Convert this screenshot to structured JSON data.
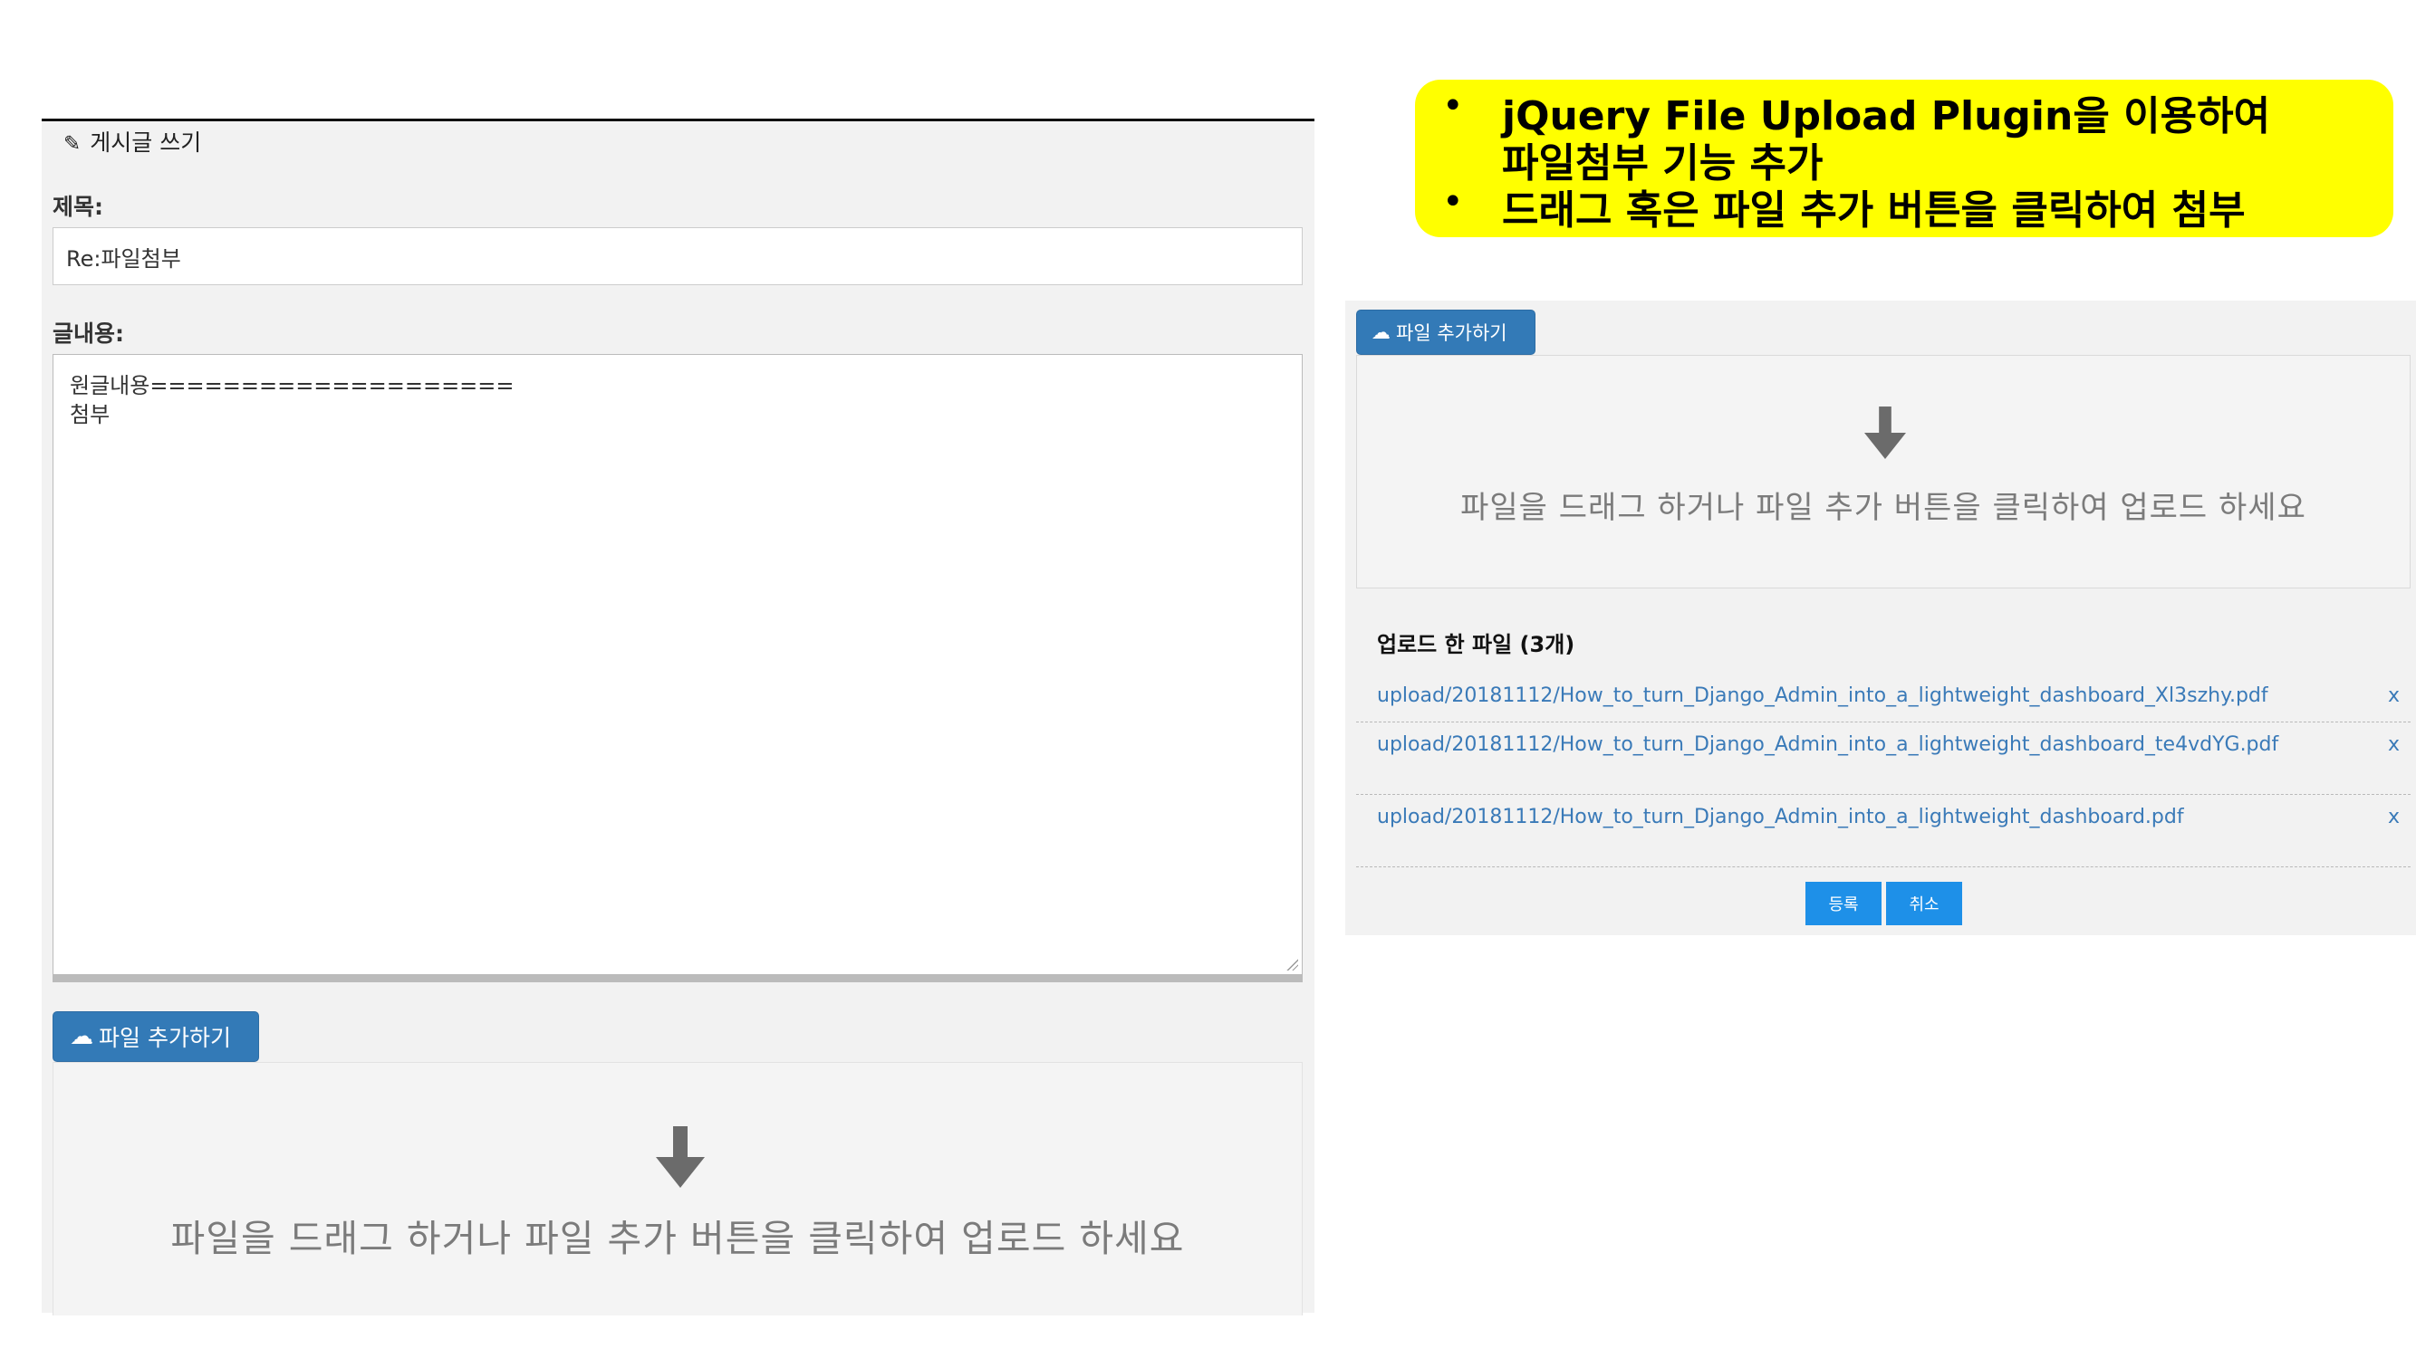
{
  "editor": {
    "title": "게시글 쓰기",
    "subject_label": "제목:",
    "subject_value": "Re:파일첨부",
    "content_label": "글내용:",
    "content_value": "원글내용====================\n첨부",
    "add_file_button": "파일 추가하기",
    "drop_text": "파일을 드래그 하거나 파일 추가 버튼을 클릭하여 업로드 하세요"
  },
  "callout": {
    "bullets": [
      "jQuery File Upload Plugin을 이용하여 파일첨부 기능 추가",
      "드래그 혹은 파일 추가 버튼을 클릭하여 첨부"
    ],
    "line1": "jQuery File Upload Plugin을 이용하여",
    "line2": "파일첨부 기능 추가",
    "line3": "드래그 혹은 파일 추가 버튼을 클릭하여 첨부",
    "color": "#ffff00"
  },
  "uploader": {
    "add_file_button": "파일 추가하기",
    "drop_text": "파일을 드래그 하거나 파일 추가 버튼을 클릭하여 업로드 하세요",
    "uploaded_title": "업로드 한 파일 (3개)",
    "files": [
      {
        "name": "upload/20181112/How_to_turn_Django_Admin_into_a_lightweight_dashboard_Xl3szhy.pdf",
        "remove": "x"
      },
      {
        "name": "upload/20181112/How_to_turn_Django_Admin_into_a_lightweight_dashboard_te4vdYG.pdf",
        "remove": "x"
      },
      {
        "name": "upload/20181112/How_to_turn_Django_Admin_into_a_lightweight_dashboard.pdf",
        "remove": "x"
      }
    ],
    "submit_button": "등록",
    "cancel_button": "취소"
  },
  "colors": {
    "primary_button": "#337ab7",
    "action_button": "#1e90e8",
    "link": "#3a7ab8",
    "panel_bg": "#f2f2f2"
  }
}
